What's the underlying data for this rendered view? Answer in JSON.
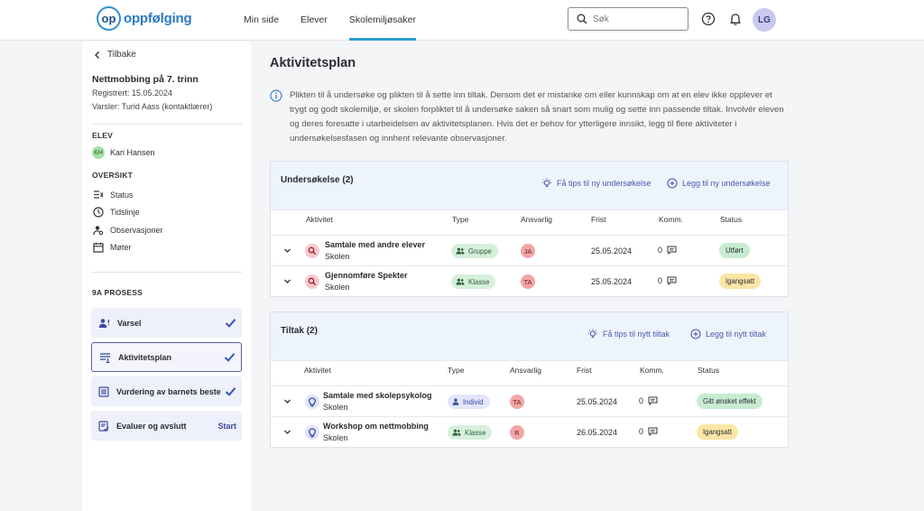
{
  "header": {
    "logo_mark": "op",
    "logo_text": "oppfølging",
    "nav": [
      {
        "label": "Min side",
        "active": false
      },
      {
        "label": "Elever",
        "active": false
      },
      {
        "label": "Skolemiljøsaker",
        "active": true
      }
    ],
    "search_placeholder": "Søk",
    "user_initials": "LG"
  },
  "sidebar": {
    "back_label": "Tilbake",
    "case_title": "Nettmobbing på 7. trinn",
    "registered": "Registrert: 15.05.2024",
    "notifier": "Varsler: Turid Aass (kontaktlærer)",
    "student_section": "ELEV",
    "student": {
      "initials": "KH",
      "name": "Kari Hansen"
    },
    "overview_section": "OVERSIKT",
    "overview_items": [
      "Status",
      "Tidslinje",
      "Observasjoner",
      "Møter"
    ],
    "process_section": "9A PROSESS",
    "process_items": [
      {
        "label": "Varsel",
        "state": "done"
      },
      {
        "label": "Aktivitetsplan",
        "state": "done"
      },
      {
        "label": "Vurdering av barnets beste",
        "state": "done"
      },
      {
        "label": "Evaluer og avslutt",
        "action": "Start"
      }
    ]
  },
  "main": {
    "title": "Aktivitetsplan",
    "info": "Plikten til å undersøke og plikten til å sette inn tiltak. Dersom det er mistanke om eller kunnskap om at en elev ikke opplever et trygt og godt skolemiljø, er skolen forpliktet til å undersøke saken så snart som mulig og sette inn passende tiltak. Involvér eleven og deres foresatte i utarbeidelsen av aktivitetsplanen. Hvis det er behov for ytterligere innsikt, legg til flere aktiviteter i undersøkelsesfasen og innhent relevante observasjoner.",
    "investigation": {
      "title": "Undersøkelse (2)",
      "tips_link": "Få tips til ny undersøkelse",
      "add_link": "Legg til ny undersøkelse",
      "columns": [
        "Aktivitet",
        "Type",
        "Ansvarlig",
        "Frist",
        "Komm.",
        "Status"
      ],
      "rows": [
        {
          "name": "Samtale med andre elever",
          "sub": "Skolen",
          "type": "Gruppe",
          "responsible": "JA",
          "due": "25.05.2024",
          "comments": "0",
          "status": "Utført"
        },
        {
          "name": "Gjennomføre Spekter",
          "sub": "Skolen",
          "type": "Klasse",
          "responsible": "TA",
          "due": "25.05.2024",
          "comments": "0",
          "status": "Igangsatt"
        }
      ]
    },
    "measures": {
      "title": "Tiltak (2)",
      "tips_link": "Få tips til nytt tiltak",
      "add_link": "Legg til nytt tiltak",
      "columns": [
        "Aktivitet",
        "Type",
        "Ansvarlig",
        "Frist",
        "Komm.",
        "Status"
      ],
      "rows": [
        {
          "name": "Samtale med skolepsykolog",
          "sub": "Skolen",
          "type": "Individ",
          "responsible": "TA",
          "due": "25.05.2024",
          "comments": "0",
          "status": "Gitt ønsket effekt"
        },
        {
          "name": "Workshop om nettmobbing",
          "sub": "Skolen",
          "type": "Klasse",
          "responsible": "R",
          "due": "26.05.2024",
          "comments": "0",
          "status": "Igangsatt"
        }
      ]
    }
  },
  "colors": {
    "accent": "#2a9fc9",
    "link": "#4a5ab0",
    "status_done": "#c7ecd0",
    "status_ongoing": "#fbe6a6",
    "type_group": "#d6f0dc",
    "type_individual": "#e3e6fb",
    "responsible": "#f3a5a5"
  }
}
